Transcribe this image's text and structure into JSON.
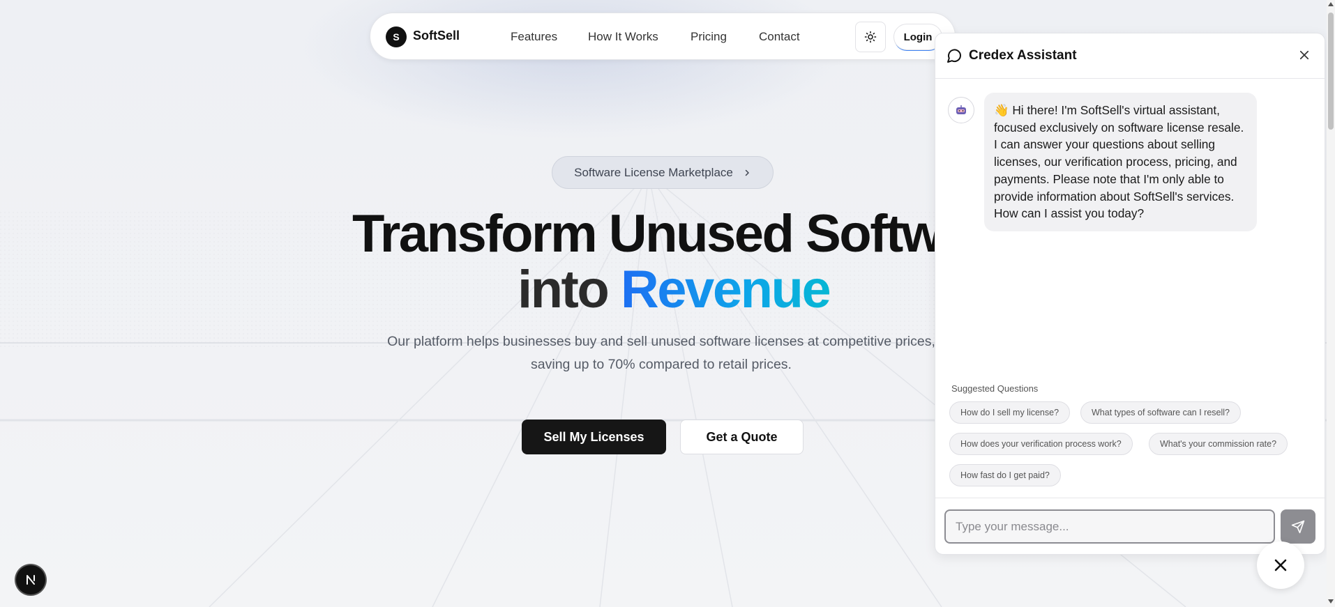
{
  "navbar": {
    "logo_letter": "S",
    "brand": "SoftSell",
    "links": [
      {
        "label": "Features"
      },
      {
        "label": "How It Works"
      },
      {
        "label": "Pricing"
      },
      {
        "label": "Contact"
      }
    ],
    "theme_icon": "sun-icon",
    "login_label": "Login"
  },
  "hero": {
    "pill_label": "Software License Marketplace",
    "title_line1": "Transform Unused Software",
    "title_line2_prefix": "into",
    "title_line2_highlight": "Revenue",
    "subtitle_line1": "Our platform helps businesses buy and sell unused software licenses at competitive prices,",
    "subtitle_line2": "saving up to 70% compared to retail prices.",
    "primary_cta": "Sell My Licenses",
    "secondary_cta": "Get a Quote"
  },
  "chat": {
    "title": "Credex Assistant",
    "message": "👋 Hi there! I'm SoftSell's virtual assistant, focused exclusively on software license resale. I can answer your questions about selling licenses, our verification process, pricing, and payments. Please note that I'm only able to provide information about SoftSell's services. How can I assist you today?",
    "suggested_label": "Suggested Questions",
    "suggestions": [
      "How do I sell my license?",
      "What types of software can I resell?",
      "How does your verification process work?",
      "What's your commission rate?",
      "How fast do I get paid?"
    ],
    "input_placeholder": "Type your message...",
    "input_value": ""
  },
  "floating": {
    "next_badge_letter": "N"
  },
  "colors": {
    "accent_gradient_start": "#1d6ff2",
    "accent_gradient_end": "#06b6d4",
    "primary_button": "#161616",
    "send_button": "#8d8d92"
  }
}
